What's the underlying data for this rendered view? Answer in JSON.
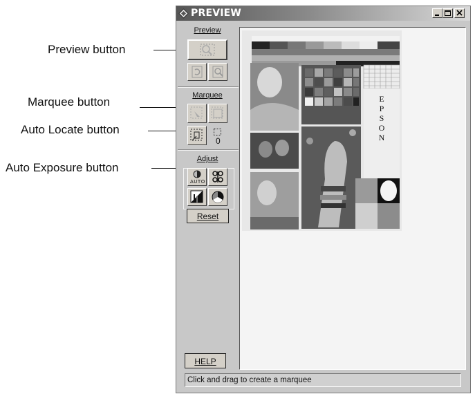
{
  "callouts": {
    "preview": "Preview button",
    "marquee": "Marquee button",
    "auto_locate": "Auto Locate button",
    "auto_exposure": "Auto Exposure button"
  },
  "window": {
    "title": "PREVIEW",
    "icons": [
      "minimize-icon",
      "maximize-icon",
      "close-icon"
    ]
  },
  "panel": {
    "preview_label": "Preview",
    "marquee_label": "Marquee",
    "marquee_count": "0",
    "adjust_label": "Adjust",
    "auto_badge": "AUTO",
    "reset_label": "Reset",
    "help_label": "HELP"
  },
  "scan": {
    "brand_letters": [
      "E",
      "P",
      "S",
      "O",
      "N"
    ]
  },
  "status": {
    "text": "Click and drag to create a marquee"
  },
  "colors": {
    "window_bg": "#c8c8c8",
    "preview_bg": "#f4f4f4",
    "button_face": "#d4d0c8"
  }
}
